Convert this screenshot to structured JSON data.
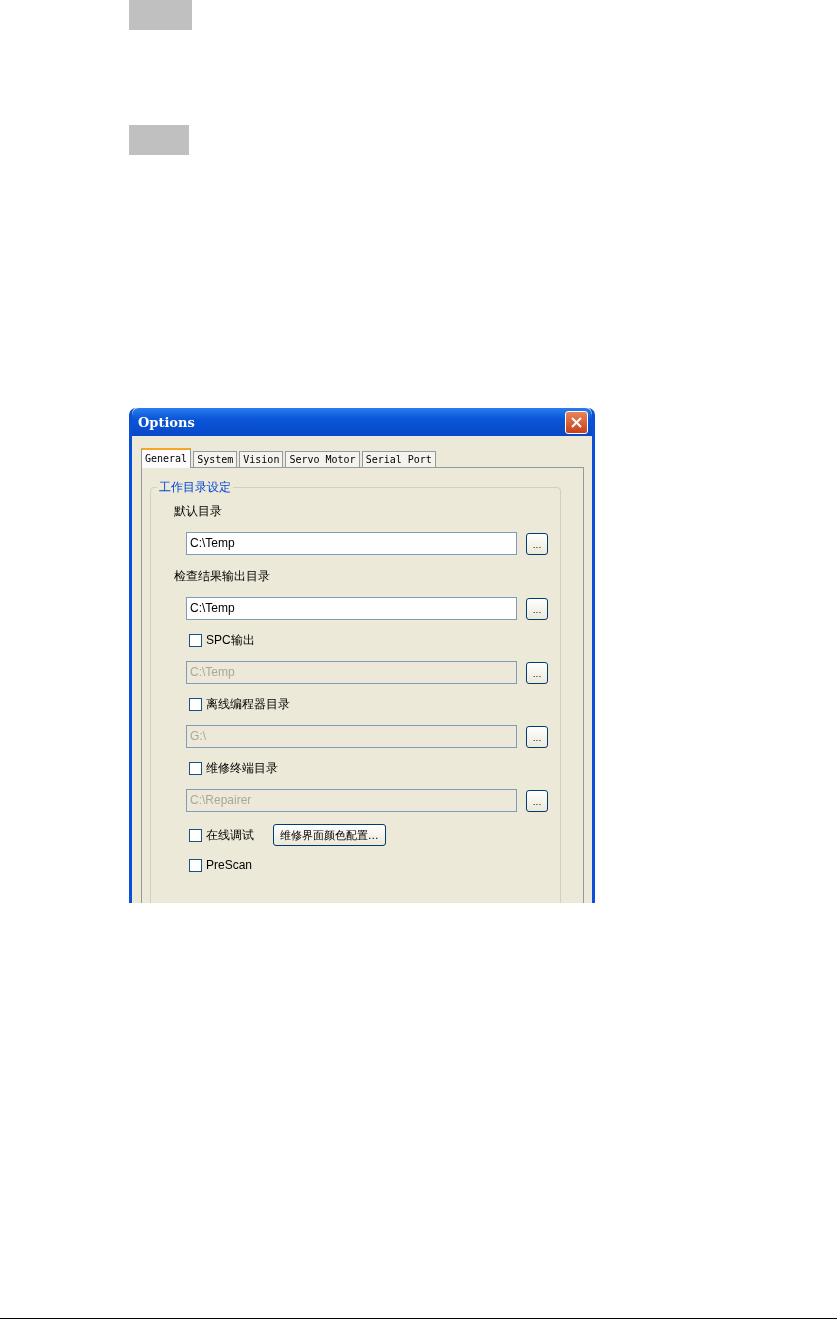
{
  "window": {
    "title": "Options"
  },
  "tabs": [
    {
      "label": "General",
      "selected": true
    },
    {
      "label": "System",
      "selected": false
    },
    {
      "label": "Vision",
      "selected": false
    },
    {
      "label": "Servo Motor",
      "selected": false
    },
    {
      "label": "Serial Port",
      "selected": false
    }
  ],
  "group": {
    "title": "工作目录设定",
    "items": [
      {
        "kind": "label",
        "text": "默认目录"
      },
      {
        "kind": "path",
        "value": "C:\\Temp",
        "disabled": false,
        "browse": "..."
      },
      {
        "kind": "label",
        "text": "检查结果输出目录"
      },
      {
        "kind": "path",
        "value": "C:\\Temp",
        "disabled": false,
        "browse": "..."
      },
      {
        "kind": "checkbox",
        "label": "SPC输出",
        "checked": false
      },
      {
        "kind": "path",
        "value": "C:\\Temp",
        "disabled": true,
        "browse": "..."
      },
      {
        "kind": "checkbox",
        "label": "离线编程器目录",
        "checked": false
      },
      {
        "kind": "path",
        "value": "G:\\",
        "disabled": true,
        "browse": "..."
      },
      {
        "kind": "checkbox",
        "label": "维修终端目录",
        "checked": false
      },
      {
        "kind": "path",
        "value": "C:\\Repairer",
        "disabled": true,
        "browse": "..."
      },
      {
        "kind": "checkbox",
        "label": "在线调试",
        "checked": false,
        "button": "维修界面颜色配置..."
      },
      {
        "kind": "checkbox",
        "label": "PreScan",
        "checked": false
      }
    ]
  }
}
